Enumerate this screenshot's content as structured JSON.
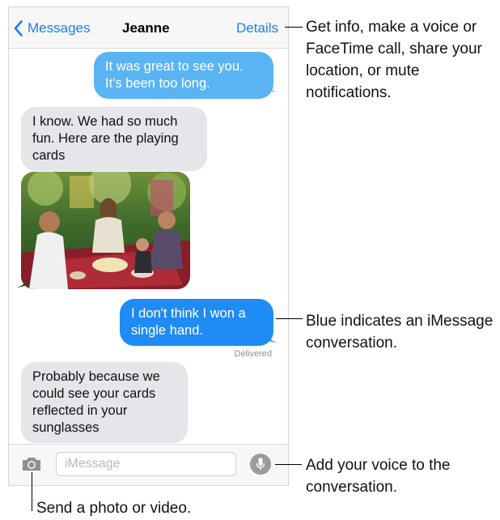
{
  "navbar": {
    "back_label": "Messages",
    "title": "Jeanne",
    "details_label": "Details"
  },
  "messages": [
    {
      "type": "sent",
      "text": "It was great to see you. It's been too long."
    },
    {
      "type": "received",
      "text": "I know. We had so much fun. Here are the playing cards"
    },
    {
      "type": "received-photo",
      "image": "photo of friends playing cards on a picnic blanket outdoors"
    },
    {
      "type": "sent",
      "text": "I don't think I won a single hand."
    },
    {
      "type": "received",
      "text": "Probably because we could see your cards reflected in your sunglasses"
    }
  ],
  "status": {
    "delivered": "Delivered"
  },
  "input": {
    "placeholder": "iMessage"
  },
  "icons": {
    "back": "chevron-left-icon",
    "camera": "camera-icon",
    "mic": "microphone-icon"
  },
  "colors": {
    "accent": "#1e7ef7",
    "sent_bubble": "#1f8cf5",
    "sent_bubble_light": "#5ab4f4",
    "received_bubble": "#e5e5ea"
  },
  "callouts": {
    "details": "Get info, make a voice or FaceTime call, share your location, or mute notifications.",
    "blue": "Blue indicates an iMessage conversation.",
    "voice": "Add your voice to the conversation.",
    "photo": "Send a photo or video."
  }
}
